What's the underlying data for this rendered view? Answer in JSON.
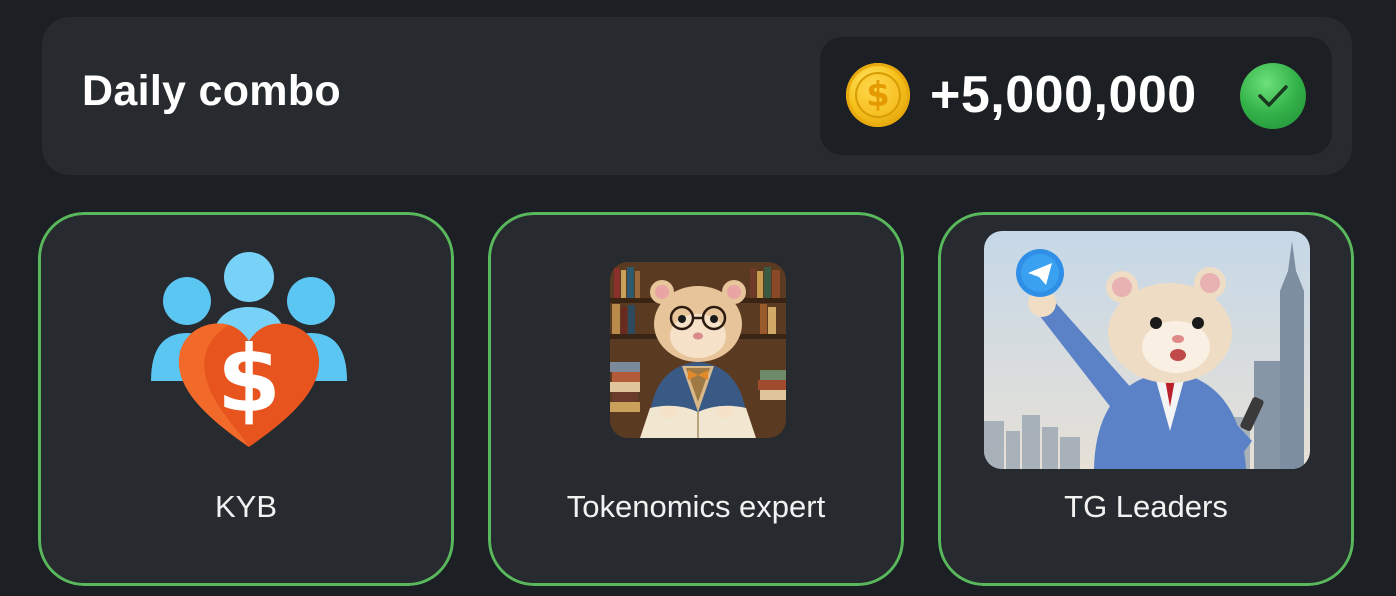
{
  "header": {
    "title": "Daily combo",
    "reward": {
      "amount": "+5,000,000",
      "coin_icon": "gold-coin-icon",
      "status_icon": "green-check-icon"
    }
  },
  "cards": [
    {
      "label": "KYB",
      "image": "people-heart-dollar-icon"
    },
    {
      "label": "Tokenomics expert",
      "image": "hamster-reading-books-image"
    },
    {
      "label": "TG Leaders",
      "image": "hamster-telegram-skyscraper-image"
    }
  ],
  "colors": {
    "background": "#1c1f24",
    "panel": "#272a2f",
    "card_border": "#5ab85c",
    "check_green": "#34b34a",
    "coin_gold": "#f7c21c"
  }
}
